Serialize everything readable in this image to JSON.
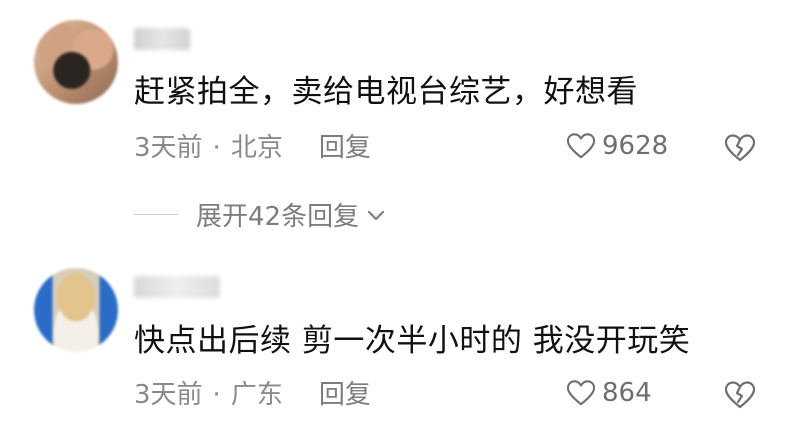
{
  "comments": [
    {
      "content": "赶紧拍全，卖给电视台综艺，好想看",
      "time": "3天前",
      "separator": "·",
      "location": "北京",
      "reply_label": "回复",
      "likes": "9628",
      "expand_label": "展开42条回复"
    },
    {
      "content": "快点出后续 剪一次半小时的 我没开玩笑",
      "time": "3天前",
      "separator": "·",
      "location": "广东",
      "reply_label": "回复",
      "likes": "864"
    }
  ],
  "icons": {
    "like": "heart-outline-icon",
    "dislike": "broken-heart-icon",
    "expand": "chevron-down-icon"
  },
  "colors": {
    "text": "#111111",
    "meta": "#8a8a8a",
    "icon": "#6f6f6f"
  }
}
